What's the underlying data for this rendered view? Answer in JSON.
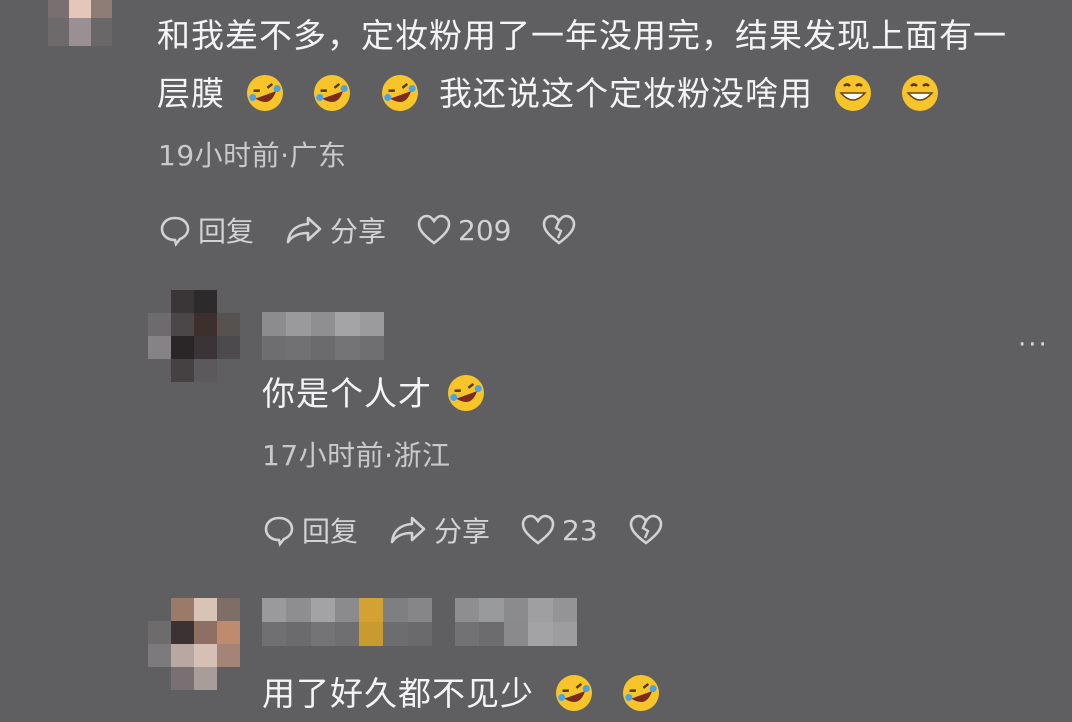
{
  "comments": [
    {
      "text_line1": "和我差不多，定妆粉用了一年没用完，结果发现上面有一",
      "text_line2_a": "层膜",
      "text_line2_b": "我还说这个定妆粉没啥用",
      "meta": "19小时前·广东",
      "reply_label": "回复",
      "share_label": "分享",
      "likes": "209"
    },
    {
      "text": "你是个人才",
      "meta": "17小时前·浙江",
      "reply_label": "回复",
      "share_label": "分享",
      "likes": "23"
    },
    {
      "text": "用了好久都不见少"
    }
  ],
  "icons": {
    "more": "more-icon",
    "reply": "comment-bubble-icon",
    "share": "share-arrow-icon",
    "like": "heart-icon",
    "dislike": "broken-heart-icon",
    "emoji_laugh": "rolling-laughing-emoji",
    "emoji_grin": "grinning-emoji"
  },
  "more_label": "···"
}
